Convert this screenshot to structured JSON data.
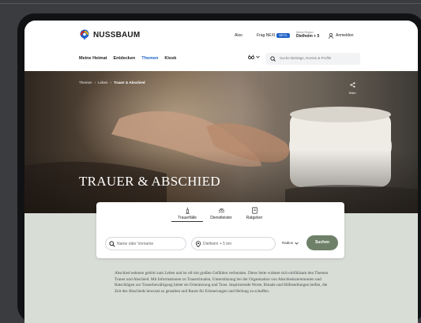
{
  "brand": {
    "name": "NUSSBAUM",
    "colors": {
      "primary": "#1f62c8",
      "accent_red": "#e2231a",
      "accent_yellow": "#f2b400",
      "sage": "#d8ddd6",
      "button": "#6f8069"
    }
  },
  "topbar": {
    "also_label": "Also",
    "frag_label": "Frag NEXI",
    "beta_label": "BETA",
    "region_caption": "Meine Region",
    "region_value": "Dielheim + 5",
    "login_label": "Anmelden",
    "icons": {
      "login": "user-icon"
    }
  },
  "nav": {
    "items": [
      {
        "label": "Meine Heimat",
        "active": false
      },
      {
        "label": "Entdecken",
        "active": false
      },
      {
        "label": "Themen",
        "active": true
      },
      {
        "label": "Kiosk",
        "active": false
      }
    ]
  },
  "search": {
    "placeholder": "Suche Beiträge, Events & Profile",
    "icons": {
      "selector": "binoculars-icon",
      "search": "search-icon"
    }
  },
  "hero": {
    "breadcrumb": [
      "Themen",
      "Leben",
      "Trauer & Abschied"
    ],
    "title": "TRAUER & ABSCHIED",
    "share_label": "Teilen"
  },
  "finder": {
    "tabs": [
      {
        "label": "Trauerfälle",
        "icon": "candle-icon",
        "active": true
      },
      {
        "label": "Dienstleister",
        "icon": "hands-icon",
        "active": false
      },
      {
        "label": "Ratgeber",
        "icon": "book-icon",
        "active": false
      }
    ],
    "name_placeholder": "Name oder Vorname",
    "location_value": "Dielheim + 5 km",
    "radius_label": "Radius",
    "submit_label": "Suchen"
  },
  "intro": {
    "text": "Abschied nehmen gehört zum Leben und ist oft mit großen Gefühlen verbunden. Diese Seite widmet sich einfühlsam den Themen Trauer und Abschied. Mit Informationen zu Trauerritualen, Unterstützung bei der Organisation von Abschiedszeremonien und Ratschlägen zur Trauerbewältigung bietet sie Orientierung und Trost. Inspirierende Worte, Rituale und Hilfestellungen helfen, die Zeit des Abschieds bewusst zu gestalten und Raum für Erinnerungen und Heilung zu schaffen."
  }
}
